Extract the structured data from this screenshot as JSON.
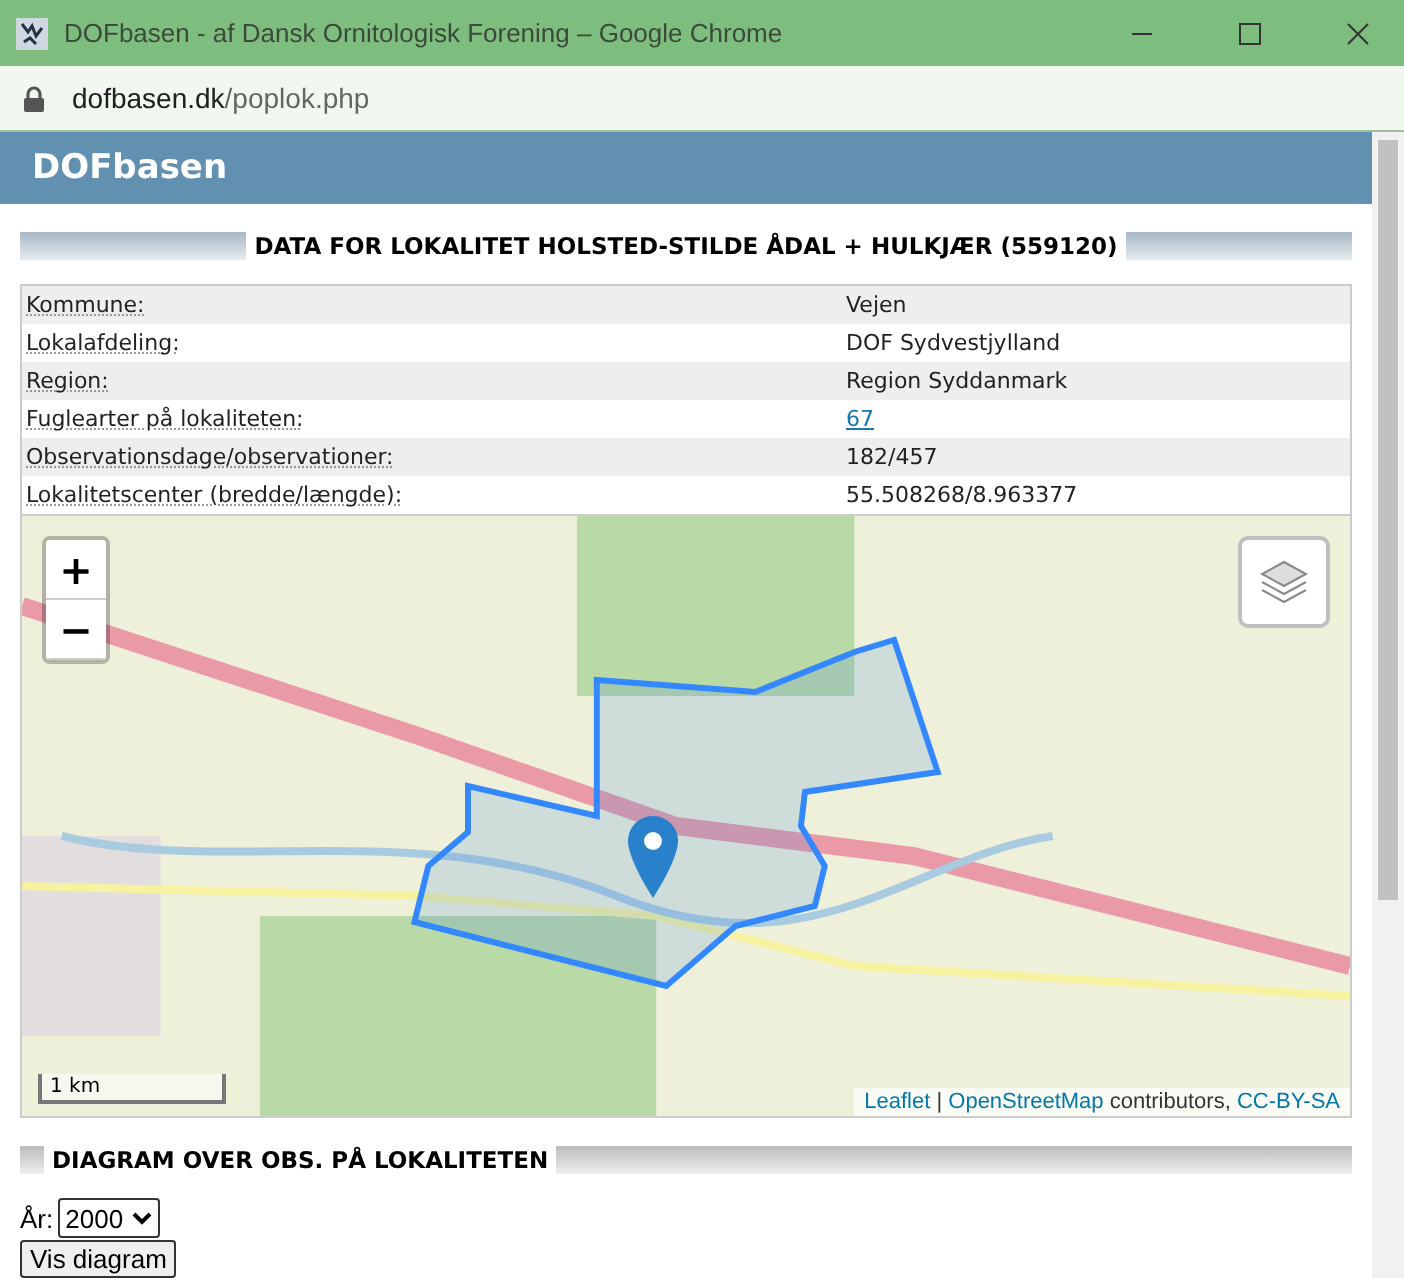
{
  "window": {
    "title": "DOFbasen - af Dansk Ornitologisk Forening – Google Chrome"
  },
  "address_bar": {
    "domain": "dofbasen.dk",
    "path": "/poplok.php"
  },
  "header": {
    "title": "DOFbasen"
  },
  "section": {
    "title": "DATA FOR LOKALITET HOLSTED-STILDE ÅDAL + HULKJÆR (559120)"
  },
  "facts": [
    {
      "label": "Kommune:",
      "value": "Vejen",
      "kind": "text"
    },
    {
      "label": "Lokalafdeling:",
      "value": "DOF Sydvestjylland",
      "kind": "text"
    },
    {
      "label": "Region:",
      "value": "Region Syddanmark",
      "kind": "text"
    },
    {
      "label": "Fuglearter på lokaliteten:",
      "value": "67",
      "kind": "link"
    },
    {
      "label": "Observationsdage/observationer:",
      "value": "182/457",
      "kind": "text"
    },
    {
      "label": "Lokalitetscenter (bredde/længde):",
      "value": "55.508268/8.963377",
      "kind": "text"
    }
  ],
  "map": {
    "zoom_in": "+",
    "zoom_out": "−",
    "scale": "1 km",
    "attribution": [
      {
        "text": "Leaflet",
        "kind": "link"
      },
      {
        "text": " | ",
        "kind": "text"
      },
      {
        "text": "OpenStreetMap",
        "kind": "link"
      },
      {
        "text": " contributors, ",
        "kind": "text"
      },
      {
        "text": "CC-BY-SA",
        "kind": "link"
      }
    ]
  },
  "diagram": {
    "title": "DIAGRAM OVER OBS. PÅ LOKALITETEN",
    "year_label": "År:",
    "year": "2000",
    "button": "Vis diagram"
  }
}
